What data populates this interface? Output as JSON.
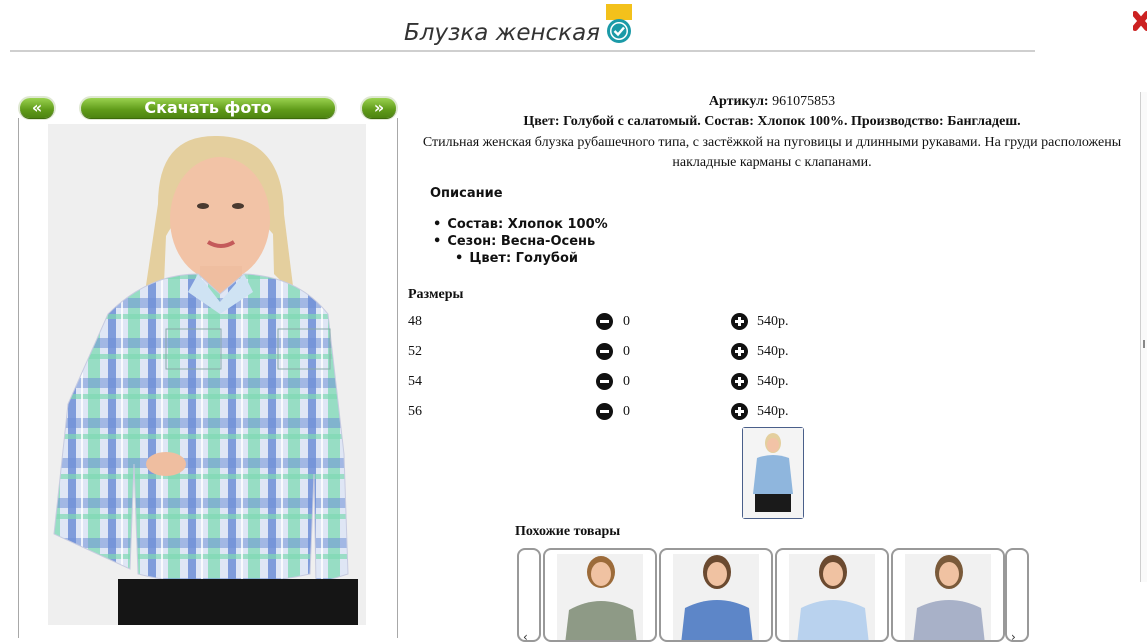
{
  "product": {
    "title": "Блузка женская",
    "sku_label": "Артикул:",
    "sku": "961075853",
    "spec_line": "Цвет: Голубой с салатомый. Состав: Хлопок 100%. Производство: Бангладеш.",
    "description": "Стильная женская блузка рубашечного типа, с застёжкой на пуговицы и длинными рукавами. На груди расположены накладные карманы с клапанами."
  },
  "photo_nav": {
    "prev": "«",
    "download": "Скачать фото",
    "next": "»"
  },
  "details": {
    "heading": "Описание",
    "items": [
      "Состав: Хлопок 100%",
      "Сезон: Весна-Осень",
      "Цвет: Голубой"
    ]
  },
  "sizes": {
    "heading": "Размеры",
    "rows": [
      {
        "size": "48",
        "qty": "0",
        "price": "540р."
      },
      {
        "size": "52",
        "qty": "0",
        "price": "540р."
      },
      {
        "size": "54",
        "qty": "0",
        "price": "540р."
      },
      {
        "size": "56",
        "qty": "0",
        "price": "540р."
      }
    ]
  },
  "similar": {
    "heading": "Похожие товары",
    "left_glyph": "‹",
    "right_glyph": "›"
  },
  "colors": {
    "accent_green": "#5f9a19",
    "badge_yellow": "#f3c11b",
    "badge_teal": "#1b9aa7",
    "close_red": "#cc2222",
    "shirt_blue": "#6f8fd6",
    "shirt_green": "#7fd9b4"
  },
  "icons": [
    "verified-badge-icon",
    "close-icon",
    "minus-circle-icon",
    "plus-circle-icon"
  ]
}
